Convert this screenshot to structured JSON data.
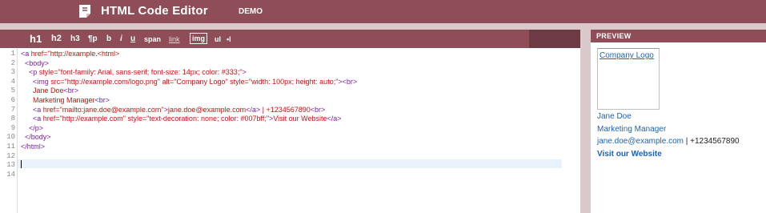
{
  "header": {
    "app_title": "HTML Code Editor",
    "demo_label": "DEMO",
    "logo_icon": "document-page-icon"
  },
  "toolbar": {
    "h1": "h1",
    "h2": "h2",
    "h3": "h3",
    "p": "¶p",
    "b": "b",
    "i": "i",
    "u": "u",
    "span": "span",
    "link": "link",
    "img": "img",
    "ul": "ul",
    "ol": "•l"
  },
  "editor": {
    "line_numbers": [
      "1",
      "2",
      "3",
      "4",
      "5",
      "6",
      "7",
      "8",
      "9",
      "10",
      "11",
      "12",
      "13",
      "14"
    ],
    "lines": [
      [
        [
          "tag",
          "<a "
        ],
        [
          "str",
          "href=\"http://example.<html>"
        ]
      ],
      [
        [
          "tag",
          "  <body>"
        ]
      ],
      [
        [
          "tag",
          "    <p "
        ],
        [
          "str",
          "style=\"font-family: Arial, sans-serif; font-size: 14px; color: #333;\""
        ],
        [
          "tag",
          ">"
        ]
      ],
      [
        [
          "tag",
          "      <img "
        ],
        [
          "str",
          "src=\"http://example.com/logo.png\" alt=\"Company Logo\" style=\"width: 100px; height: auto;\""
        ],
        [
          "tag",
          "><br>"
        ]
      ],
      [
        [
          "str",
          "      Jane Doe"
        ],
        [
          "tag",
          "<br>"
        ]
      ],
      [
        [
          "str",
          "      Marketing Manager"
        ],
        [
          "tag",
          "<br>"
        ]
      ],
      [
        [
          "tag",
          "      <a "
        ],
        [
          "str",
          "href=\"mailto:jane.doe@example.com\""
        ],
        [
          "tag",
          ">"
        ],
        [
          "str",
          "jane.doe@example.com"
        ],
        [
          "tag",
          "</a>"
        ],
        [
          "str",
          " | +1234567890"
        ],
        [
          "tag",
          "<br>"
        ]
      ],
      [
        [
          "tag",
          "      <a "
        ],
        [
          "str",
          "href=\"http://example.com\" style=\"text-decoration: none; color: #007bff;\""
        ],
        [
          "tag",
          ">"
        ],
        [
          "str",
          "Visit our Website"
        ],
        [
          "tag",
          "</a>"
        ]
      ],
      [
        [
          "tag",
          "    </p>"
        ]
      ],
      [
        [
          "tag",
          "  </body>"
        ]
      ],
      [
        [
          "tag",
          "</html>"
        ]
      ],
      [],
      [],
      []
    ]
  },
  "preview": {
    "title": "PREVIEW",
    "logo_alt": "Company Logo",
    "name": "Jane Doe",
    "job_title": "Marketing Manager",
    "email": "jane.doe@example.com",
    "separator": " | ",
    "phone": "+1234567890",
    "website_label": "Visit our Website"
  },
  "colors": {
    "brand": "#8f4d57",
    "tag": "#7a1fa0",
    "string": "#cc1111",
    "link": "#1a62b8"
  }
}
